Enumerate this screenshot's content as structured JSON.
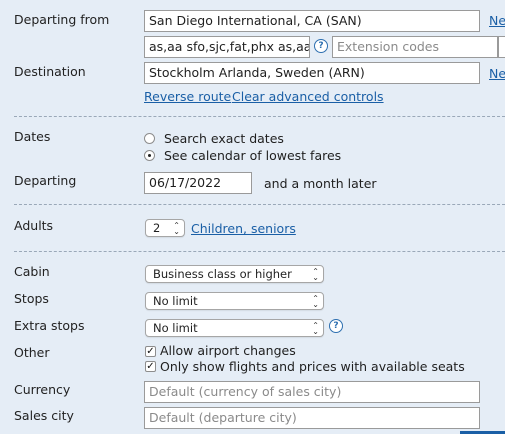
{
  "route": {
    "departing_label": "Departing from",
    "origin_value": "San Diego International, CA (SAN)",
    "origin_link": "Ne",
    "routing_value": "as,aa sfo,sjc,fat,phx as,aa",
    "extension_placeholder": "Extension codes",
    "destination_label": "Destination",
    "destination_value": "Stockholm Arlanda, Sweden (ARN)",
    "destination_link": "Ne",
    "reverse_route": "Reverse route",
    "clear_advanced": "Clear advanced controls"
  },
  "dates": {
    "label": "Dates",
    "option_exact": "Search exact dates",
    "option_calendar": "See calendar of lowest fares",
    "selected": "calendar",
    "departing_label": "Departing",
    "departing_value": "06/17/2022",
    "range_text": "and a month later"
  },
  "passengers": {
    "adults_label": "Adults",
    "adults_value": "2",
    "children_link": "Children, seniors"
  },
  "options": {
    "cabin_label": "Cabin",
    "cabin_value": "Business class or higher",
    "stops_label": "Stops",
    "stops_value": "No limit",
    "extra_stops_label": "Extra stops",
    "extra_stops_value": "No limit",
    "other_label": "Other",
    "allow_airport_changes": "Allow airport changes",
    "allow_airport_changes_checked": true,
    "only_available": "Only show flights and prices with available seats",
    "only_available_checked": true,
    "currency_label": "Currency",
    "currency_placeholder": "Default (currency of sales city)",
    "sales_city_label": "Sales city",
    "sales_city_placeholder": "Default (departure city)"
  },
  "icons": {
    "help": "question-mark-icon",
    "check": "checkmark-icon",
    "arrows": "updown-arrow-icon"
  },
  "colors": {
    "background": "#e5edf6",
    "link": "#1a5fa6",
    "help_icon": "#2d6fb0"
  }
}
